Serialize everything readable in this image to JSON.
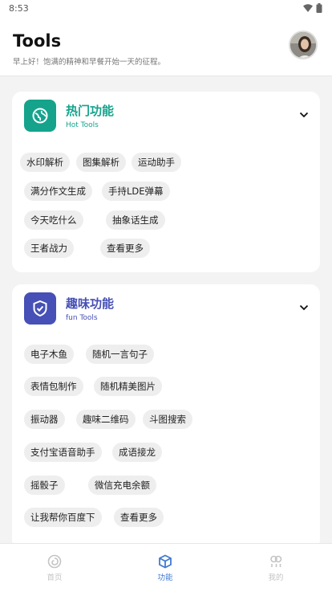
{
  "status_bar": {
    "time": "8:53"
  },
  "header": {
    "title": "Tools",
    "subtitle": "早上好！饱满的精神和早餐开始一天的征程。"
  },
  "sections": [
    {
      "title": "热门功能",
      "subtitle": "Hot Tools",
      "icon": "globe-icon",
      "color": "#15a38c",
      "chips": [
        "水印解析",
        "图集解析",
        "运动助手",
        "满分作文生成",
        "手持LDE弹幕",
        "今天吃什么",
        "抽象话生成",
        "王者战力",
        "查看更多"
      ]
    },
    {
      "title": "趣味功能",
      "subtitle": "fun Tools",
      "icon": "shield-check-icon",
      "color": "#4650b6",
      "chips": [
        "电子木鱼",
        "随机一言句子",
        "表情包制作",
        "随机精美图片",
        "振动器",
        "趣味二维码",
        "斗图搜索",
        "支付宝语音助手",
        "成语接龙",
        "摇骰子",
        "微信充电余额",
        "让我帮你百度下",
        "查看更多"
      ]
    }
  ],
  "bottom_nav": [
    {
      "label": "首页",
      "icon": "home-swirl-icon",
      "active": false
    },
    {
      "label": "功能",
      "icon": "cube-icon",
      "active": true
    },
    {
      "label": "我的",
      "icon": "people-icon",
      "active": false
    }
  ],
  "colors": {
    "hot": "#15a38c",
    "fun": "#4650b6",
    "nav_active": "#3f7ad3",
    "nav_inactive": "#c4c4c4"
  }
}
